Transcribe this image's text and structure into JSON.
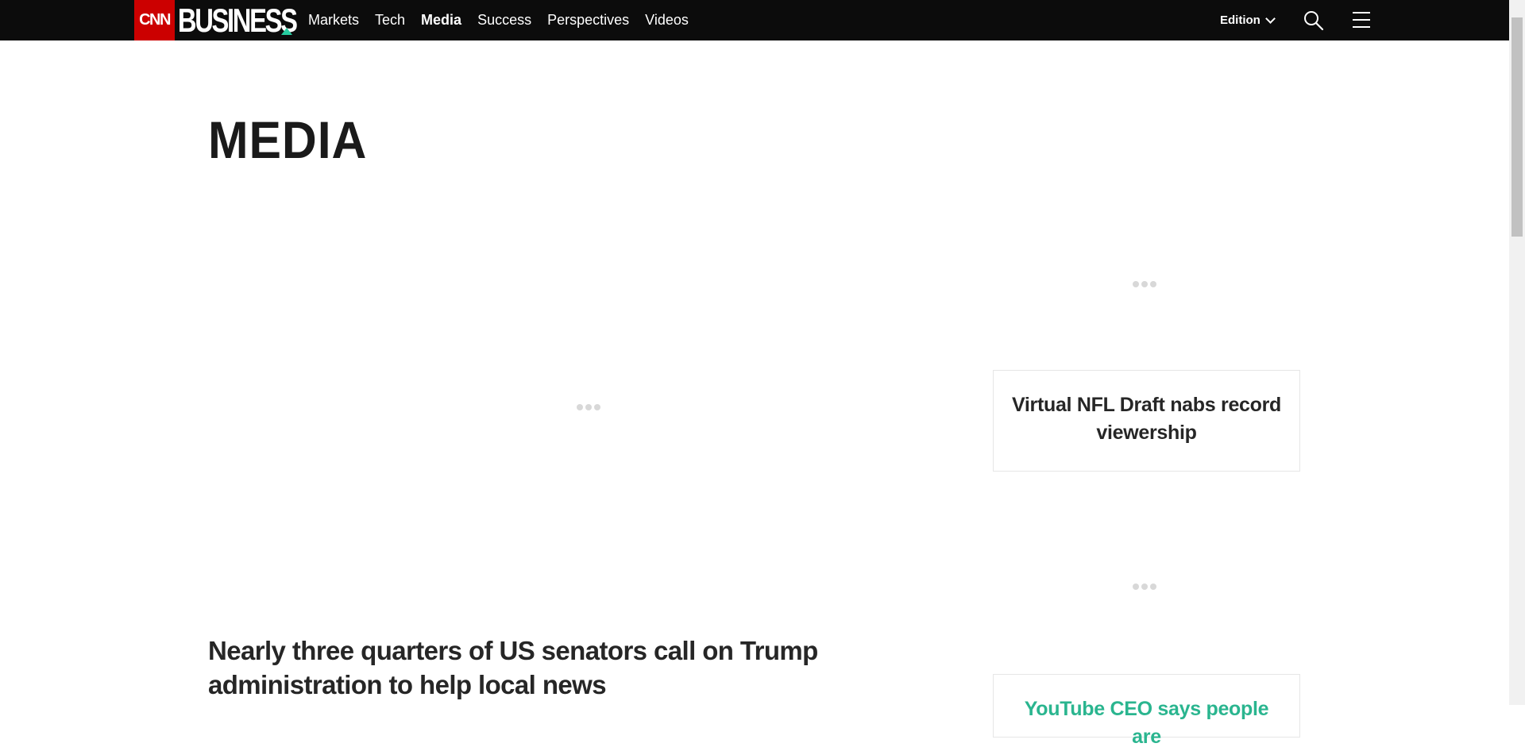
{
  "header": {
    "logo_cnn": "CNN",
    "logo_business": "BUSINESS",
    "nav": [
      {
        "label": "Markets"
      },
      {
        "label": "Tech"
      },
      {
        "label": "Media"
      },
      {
        "label": "Success"
      },
      {
        "label": "Perspectives"
      },
      {
        "label": "Videos"
      }
    ],
    "active_nav": "Media",
    "edition_label": "Edition",
    "icons": {
      "search": "search-icon",
      "menu": "hamburger-menu-icon",
      "edition": "chevron-down-icon"
    },
    "colors": {
      "bar": "#0c0c0c",
      "cnn_red": "#cc0000",
      "accent": "#26cc9f"
    }
  },
  "page": {
    "section_title": "MEDIA"
  },
  "side_cards": [
    {
      "title": "Virtual NFL Draft nabs record viewership"
    },
    {
      "title": "YouTube CEO says people are"
    }
  ],
  "main_story": {
    "headline": "Nearly three quarters of US senators call on Trump administration to help local news"
  }
}
